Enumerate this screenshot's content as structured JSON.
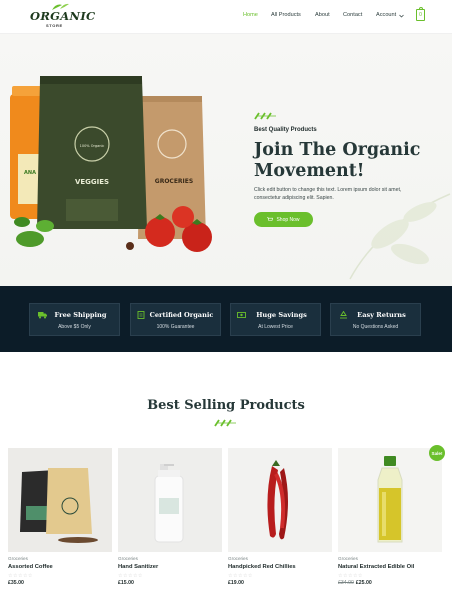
{
  "brand": {
    "logo_word": "ORGANIC",
    "logo_sub": "STORE"
  },
  "nav": {
    "items": [
      {
        "label": "Home",
        "active": true
      },
      {
        "label": "All Products"
      },
      {
        "label": "About"
      },
      {
        "label": "Contact"
      },
      {
        "label": "Account"
      }
    ],
    "cart_count": "0"
  },
  "hero": {
    "eyebrow": "Best Quality Products",
    "headline": "Join The Organic Movement!",
    "description": "Click edit button to change this text. Lorem ipsum dolor sit amet, consectetur adipiscing elit. Sapien.",
    "button_label": "Shop Now",
    "bag_front_label": "VEGGIES",
    "bag_front_badge": "100% Organic",
    "bag_back_label": "GROCERIES",
    "jar_label": "ANA"
  },
  "features": [
    {
      "title": "Free Shipping",
      "subtitle": "Above $5 Only",
      "icon": "truck-icon"
    },
    {
      "title": "Certified Organic",
      "subtitle": "100% Guarantee",
      "icon": "certificate-icon"
    },
    {
      "title": "Huge Savings",
      "subtitle": "At Lowest Price",
      "icon": "money-icon"
    },
    {
      "title": "Easy Returns",
      "subtitle": "No Questions Asked",
      "icon": "recycle-icon"
    }
  ],
  "best_selling": {
    "title": "Best Selling Products",
    "sale_badge": "Sale!",
    "products": [
      {
        "category": "Groceries",
        "name": "Assorted Coffee",
        "price": "£35.00",
        "old_price": ""
      },
      {
        "category": "Groceries",
        "name": "Hand Sanitizer",
        "price": "£15.00",
        "old_price": ""
      },
      {
        "category": "Groceries",
        "name": "Handpicked Red Chillies",
        "price": "£19.00",
        "old_price": ""
      },
      {
        "category": "Groceries",
        "name": "Natural Extracted Edible Oil",
        "price": "£25.00",
        "old_price": "£34.00"
      }
    ],
    "stars": "☆☆☆☆☆"
  },
  "colors": {
    "accent": "#6abf2c",
    "dark_band": "#0c1c28",
    "text": "#263838"
  }
}
